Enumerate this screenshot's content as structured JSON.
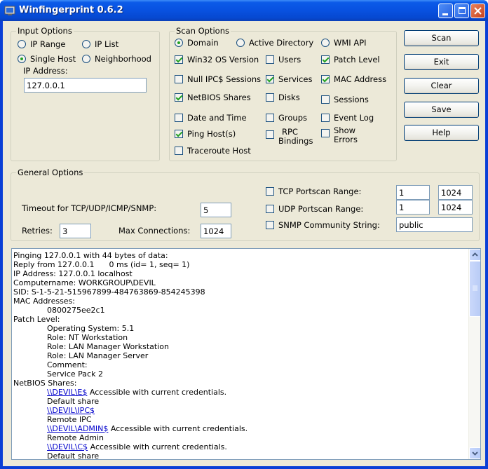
{
  "window": {
    "title": "Winfingerprint 0.6.2"
  },
  "input_options": {
    "label": "Input Options",
    "ip_range": "IP Range",
    "ip_list": "IP List",
    "single_host": "Single Host",
    "neighborhood": "Neighborhood",
    "ip_address_label": "IP Address:",
    "ip_address_value": "127.0.0.1"
  },
  "scan_options": {
    "label": "Scan Options",
    "domain": "Domain",
    "active_directory": "Active Directory",
    "wmi_api": "WMI API",
    "win32_os_version": "Win32 OS Version",
    "users": "Users",
    "patch_level": "Patch Level",
    "null_ipc_sessions": "Null IPC$ Sessions",
    "services": "Services",
    "mac_address": "MAC Address",
    "netbios_shares": "NetBIOS Shares",
    "disks": "Disks",
    "sessions": "Sessions",
    "date_and_time": "Date and Time",
    "groups": "Groups",
    "event_log": "Event Log",
    "ping_hosts": "Ping Host(s)",
    "rpc_bindings_1": "RPC",
    "rpc_bindings_2": "Bindings",
    "show_errors_1": "Show",
    "show_errors_2": "Errors",
    "traceroute_host": "Traceroute Host"
  },
  "buttons": {
    "scan": "Scan",
    "exit": "Exit",
    "clear": "Clear",
    "save": "Save",
    "help": "Help"
  },
  "general_options": {
    "label": "General Options",
    "timeout_label": "Timeout for TCP/UDP/ICMP/SNMP:",
    "timeout_value": "5",
    "retries_label": "Retries:",
    "retries_value": "3",
    "max_connections_label": "Max Connections:",
    "max_connections_value": "1024",
    "tcp_portscan_label": "TCP Portscan Range:",
    "tcp_from": "1",
    "tcp_to": "1024",
    "udp_portscan_label": "UDP Portscan Range:",
    "udp_from": "1",
    "udp_to": "1024",
    "snmp_label": "SNMP Community String:",
    "snmp_value": "public"
  },
  "output": {
    "lines": [
      {
        "indent": 0,
        "text": "Pinging 127.0.0.1 with 44 bytes of data:"
      },
      {
        "indent": 0,
        "text": "Reply from 127.0.0.1      0 ms (id= 1, seq= 1)"
      },
      {
        "indent": 0,
        "text": "IP Address: 127.0.0.1 localhost"
      },
      {
        "indent": 0,
        "text": "Computername: WORKGROUP\\DEVIL"
      },
      {
        "indent": 0,
        "text": "SID: S-1-5-21-515967899-484763869-854245398"
      },
      {
        "indent": 0,
        "text": "MAC Addresses:"
      },
      {
        "indent": 1,
        "text": "0800275ee2c1"
      },
      {
        "indent": 0,
        "text": "Patch Level:"
      },
      {
        "indent": 1,
        "text": "Operating System: 5.1"
      },
      {
        "indent": 1,
        "text": "Role: NT Workstation"
      },
      {
        "indent": 1,
        "text": "Role: LAN Manager Workstation"
      },
      {
        "indent": 1,
        "text": "Role: LAN Manager Server"
      },
      {
        "indent": 1,
        "text": "Comment:"
      },
      {
        "indent": 1,
        "text": "Service Pack 2"
      },
      {
        "indent": 0,
        "text": "NetBIOS Shares:"
      },
      {
        "indent": 1,
        "link": "\\\\DEVIL\\E$",
        "text": " Accessible with current credentials."
      },
      {
        "indent": 1,
        "text": "Default share"
      },
      {
        "indent": 1,
        "link": "\\\\DEVIL\\IPC$",
        "text": ""
      },
      {
        "indent": 1,
        "text": "Remote IPC"
      },
      {
        "indent": 1,
        "link": "\\\\DEVIL\\ADMIN$",
        "text": " Accessible with current credentials."
      },
      {
        "indent": 1,
        "text": "Remote Admin"
      },
      {
        "indent": 1,
        "link": "\\\\DEVIL\\C$",
        "text": " Accessible with current credentials."
      },
      {
        "indent": 1,
        "text": "Default share"
      }
    ]
  }
}
